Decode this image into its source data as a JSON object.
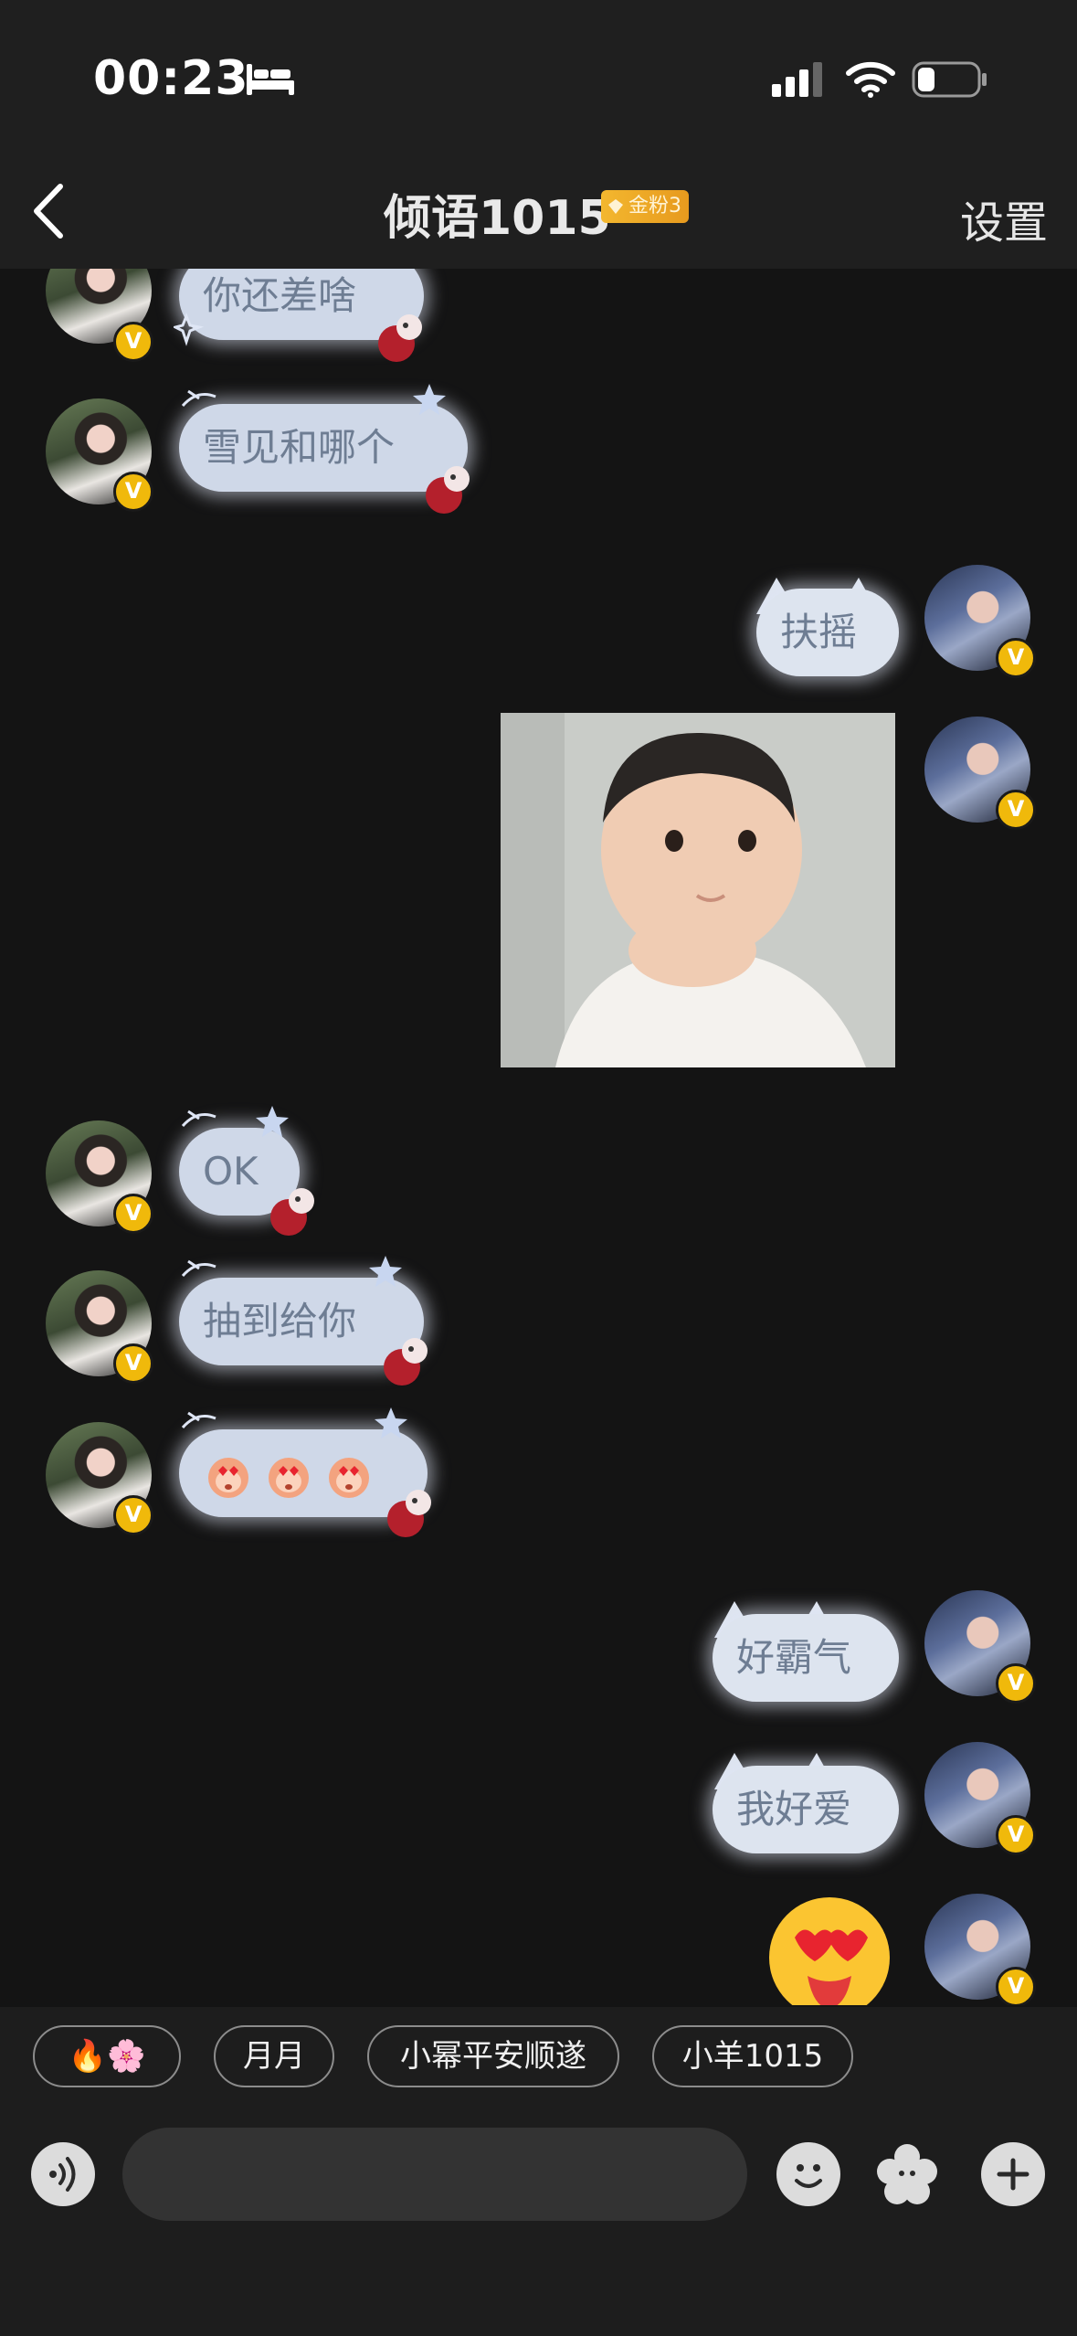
{
  "status_bar": {
    "time": "00:23"
  },
  "nav": {
    "title": "倾语1015",
    "fan_badge": "金粉3",
    "settings": "设置"
  },
  "messages": [
    {
      "side": "left",
      "text": "你还差啥"
    },
    {
      "side": "left",
      "text": "雪见和哪个"
    },
    {
      "side": "right",
      "text": "扶摇"
    },
    {
      "side": "right",
      "type": "image",
      "description": "baby-photo"
    },
    {
      "side": "left",
      "text": "OK"
    },
    {
      "side": "left",
      "text": "抽到给你"
    },
    {
      "side": "left",
      "type": "emoji",
      "emojis": [
        "heart-eyes-monkey",
        "heart-eyes-monkey",
        "heart-eyes-monkey"
      ]
    },
    {
      "side": "right",
      "text": "好霸气"
    },
    {
      "side": "right",
      "text": "我好爱"
    },
    {
      "side": "right",
      "type": "emoji",
      "emojis": [
        "heart-eyes-tongue-face"
      ]
    }
  ],
  "quick_replies": [
    "🔥🌸",
    "月月",
    "小幂平安顺遂",
    "小羊1015"
  ],
  "input": {
    "placeholder": ""
  },
  "colors": {
    "badge_gold": "#f0b90b",
    "bubble": "#cfd8e8",
    "background": "#141414"
  }
}
